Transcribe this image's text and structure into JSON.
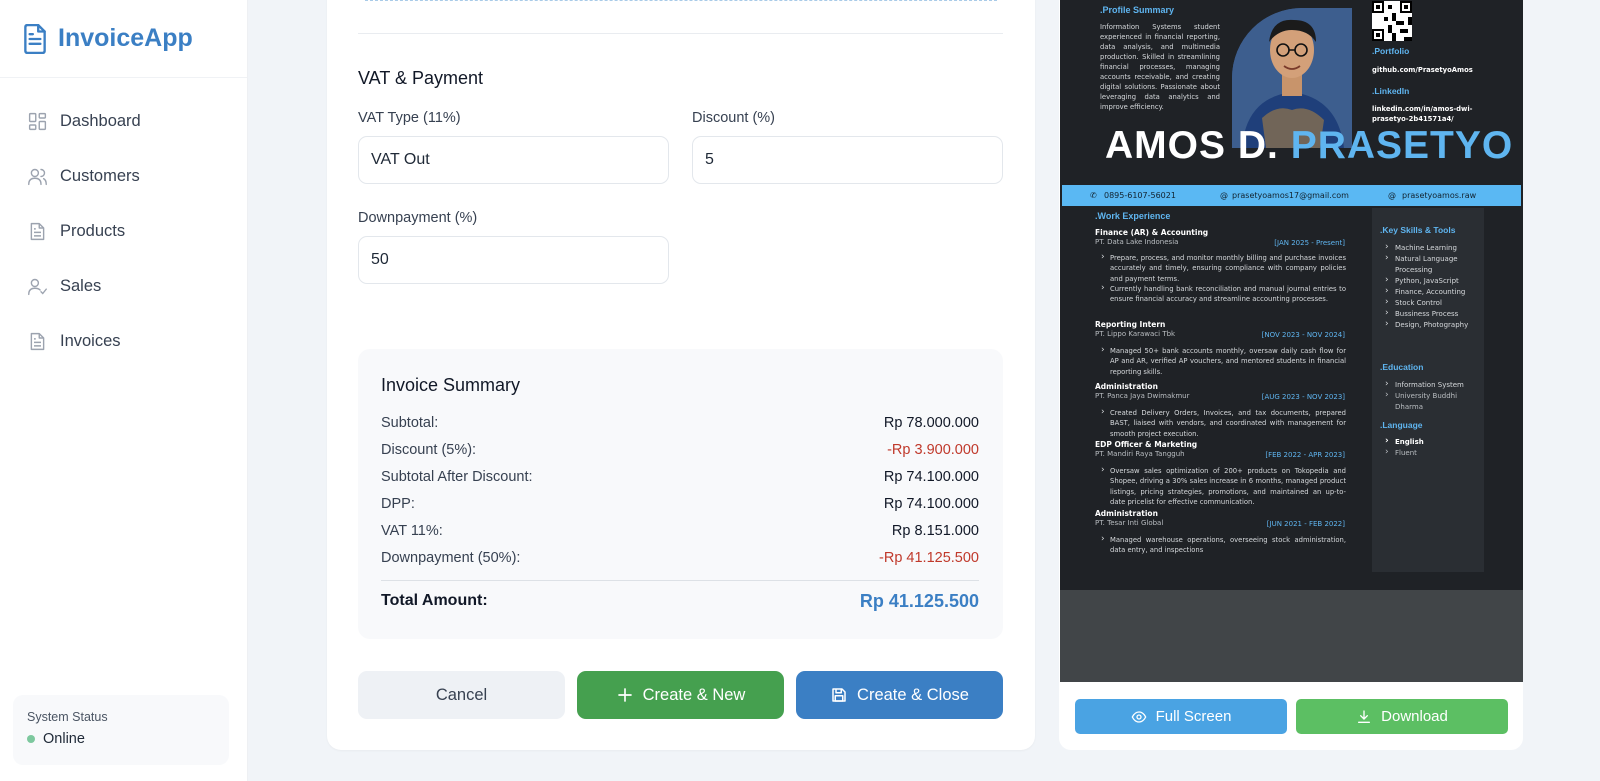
{
  "app": {
    "name": "InvoiceApp"
  },
  "sidebar": {
    "items": [
      {
        "label": "Dashboard",
        "icon": "dashboard-icon"
      },
      {
        "label": "Customers",
        "icon": "users-icon"
      },
      {
        "label": "Products",
        "icon": "document-icon"
      },
      {
        "label": "Sales",
        "icon": "user-check-icon"
      },
      {
        "label": "Invoices",
        "icon": "document-icon"
      }
    ],
    "status": {
      "title": "System Status",
      "value": "Online",
      "color": "#7dc89e"
    }
  },
  "form": {
    "section_title": "VAT & Payment",
    "vat_type": {
      "label": "VAT Type (11%)",
      "value": "VAT Out"
    },
    "discount": {
      "label": "Discount (%)",
      "value": "5"
    },
    "downpayment": {
      "label": "Downpayment (%)",
      "value": "50"
    }
  },
  "summary": {
    "title": "Invoice Summary",
    "rows": [
      {
        "label": "Subtotal:",
        "value": "Rp 78.000.000"
      },
      {
        "label": "Discount (5%):",
        "value": "-Rp 3.900.000"
      },
      {
        "label": "Subtotal After Discount:",
        "value": "Rp 74.100.000"
      },
      {
        "label": "DPP:",
        "value": "Rp 74.100.000"
      },
      {
        "label": "VAT 11%:",
        "value": "Rp 8.151.000"
      },
      {
        "label": "Downpayment (50%):",
        "value": "-Rp 41.125.500"
      }
    ],
    "total_label": "Total Amount:",
    "total_value": "Rp 41.125.500"
  },
  "actions": {
    "cancel": "Cancel",
    "create_new": "Create & New",
    "create_close": "Create & Close"
  },
  "preview": {
    "full_screen": "Full Screen",
    "download": "Download",
    "cv": {
      "profile_heading": ".Profile Summary",
      "profile_text": "Information Systems student experienced in financial reporting, data analysis, and multimedia production. Skilled in streamlining financial processes, managing accounts receivable, and creating digital solutions. Passionate about leveraging data analytics and improve efficiency.",
      "portfolio_heading": ".Portfolio",
      "portfolio_value": "github.com/PrasetyoAmos",
      "linkedin_heading": ".LinkedIn",
      "linkedin_value": "linkedin.com/in/amos-dwi-prasetyo-2b41571a4/",
      "name_first": "AMOS D.",
      "name_last": "PRASETYO",
      "phone": "0895-6107-56021",
      "email": "prasetyoamos17@gmail.com",
      "social": "prasetyoamos.raw",
      "work_heading": ".Work Experience",
      "jobs": [
        {
          "title": "Finance (AR) & Accounting",
          "org": "PT. Data Lake Indonesia",
          "date": "[JAN 2025 - Present]",
          "bullets": [
            "Prepare, process, and monitor monthly billing and purchase invoices accurately and timely, ensuring compliance with company policies and payment terms.",
            "Currently handling bank reconciliation and manual journal entries to ensure financial accuracy and streamline accounting processes."
          ]
        },
        {
          "title": "Reporting Intern",
          "org": "PT. Lippo Karawaci Tbk",
          "date": "[NOV 2023 - NOV 2024]",
          "bullets": [
            "Managed 50+ bank accounts monthly, oversaw daily cash flow for AP and AR, verified AP vouchers, and mentored students in financial reporting skills."
          ]
        },
        {
          "title": "Administration",
          "org": "PT. Panca Jaya Dwimakmur",
          "date": "[AUG 2023 - NOV 2023]",
          "bullets": [
            "Created Delivery Orders, Invoices, and tax documents, prepared BAST, liaised with vendors, and coordinated with management for smooth project execution."
          ]
        },
        {
          "title": "EDP Officer & Marketing",
          "org": "PT. Mandiri Raya Tangguh",
          "date": "[FEB 2022 - APR 2023]",
          "bullets": [
            "Oversaw sales optimization of 200+ products on Tokopedia and Shopee, driving a 30% sales increase in 6 months, managed product listings, pricing strategies, promotions, and maintained an up-to-date pricelist for effective communication."
          ]
        },
        {
          "title": "Administration",
          "org": "PT. Tesar Inti Global",
          "date": "[JUN 2021 - FEB 2022]",
          "bullets": [
            "Managed warehouse operations, overseeing stock administration, data entry, and inspections"
          ]
        }
      ],
      "skills_heading": ".Key Skills & Tools",
      "skills": [
        "Machine Learning",
        "Natural Language Processing",
        "Python, JavaScript",
        "Finance, Accounting",
        "Stock Control",
        "Bussiness Process",
        "Design, Photography"
      ],
      "education_heading": ".Education",
      "education": [
        "Information System",
        "University Buddhi Dharma"
      ],
      "language_heading": ".Language",
      "language": [
        "English",
        "Fluent"
      ]
    }
  },
  "colors": {
    "primary": "#3b7fc4",
    "success": "#45a04f",
    "danger": "#c0392b",
    "accent": "#5fb5f0"
  }
}
